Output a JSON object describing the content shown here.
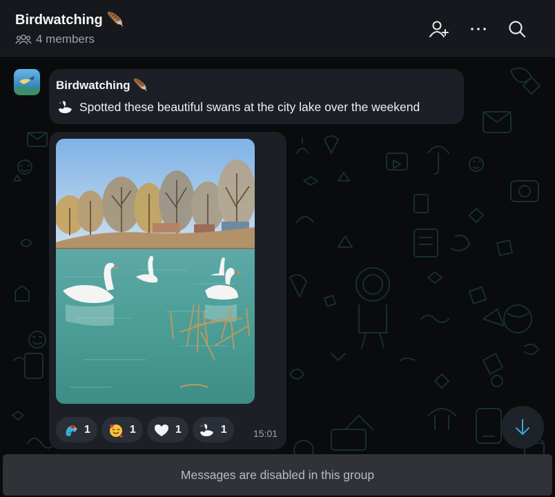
{
  "header": {
    "title": "Birdwatching",
    "title_emoji": "🪶",
    "members": "4 members"
  },
  "message1": {
    "sender": "Birdwatching",
    "sender_emoji": "🪶",
    "text": "Spotted these beautiful swans at the city lake over the weekend"
  },
  "message2": {
    "reactions": [
      {
        "icon": "parrot-emoji",
        "count": "1"
      },
      {
        "icon": "smiling-face-with-hearts-emoji",
        "count": "1"
      },
      {
        "icon": "white-heart-emoji",
        "count": "1"
      },
      {
        "icon": "swan-emoji",
        "count": "1"
      }
    ],
    "time": "15:01"
  },
  "footer": {
    "disabled_text": "Messages are disabled in this group"
  },
  "colors": {
    "background": "#0a0b0d",
    "header": "#16181d",
    "bubble": "#1c1f25",
    "accent": "#3aa9d8"
  }
}
